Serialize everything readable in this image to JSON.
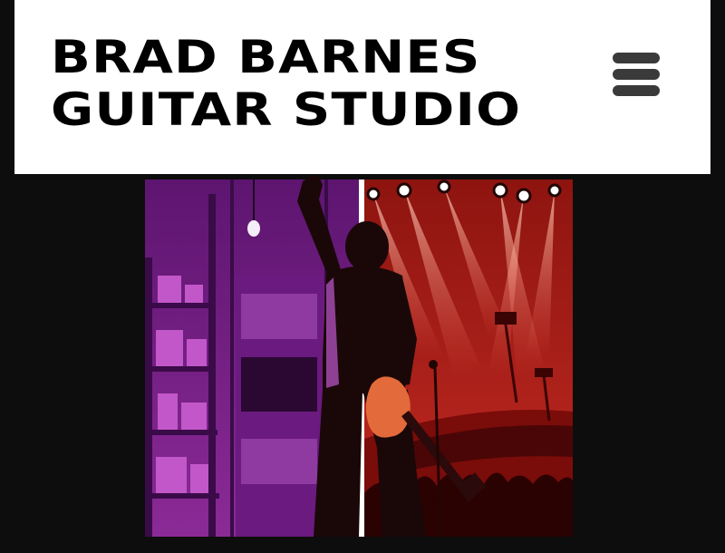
{
  "header": {
    "title_line1": "BRAD BARNES",
    "title_line2": "GUITAR STUDIO",
    "menu_icon": "hamburger-menu-icon"
  },
  "hero": {
    "description_icon": "guitarist-stage-illustration",
    "colors": {
      "left_panel": "#7a1f8a",
      "right_panel": "#b8201c",
      "silhouette": "#1a0a0a",
      "divider": "#ffffff"
    }
  },
  "colors": {
    "page_background": "#0d0d0d",
    "header_background": "#ffffff",
    "title_text": "#000000",
    "menu_bars": "#3a3a3a"
  }
}
